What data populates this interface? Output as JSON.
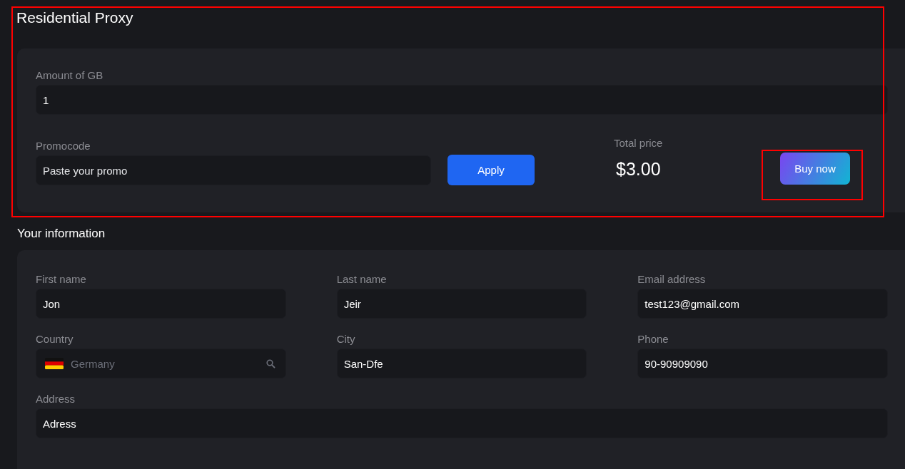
{
  "title": "Residential Proxy",
  "order": {
    "amount": {
      "label": "Amount of GB",
      "value": "1"
    },
    "promocode": {
      "label": "Promocode",
      "placeholder": "Paste your promo"
    },
    "apply_button": "Apply",
    "total": {
      "label": "Total price",
      "value": "$3.00"
    },
    "buy_button": "Buy now"
  },
  "info": {
    "title": "Your information",
    "fields": [
      {
        "kind": "text",
        "label": "First name",
        "value": "Jon"
      },
      {
        "kind": "text",
        "label": "Last name",
        "value": "Jeir"
      },
      {
        "kind": "text",
        "label": "Email address",
        "value": "test123@gmail.com"
      },
      {
        "kind": "country",
        "label": "Country",
        "placeholder": "Germany"
      },
      {
        "kind": "text",
        "label": "City",
        "value": "San-Dfe"
      },
      {
        "kind": "text",
        "label": "Phone",
        "value": "90-90909090"
      },
      {
        "kind": "wide",
        "label": "Address",
        "value": "Adress"
      }
    ]
  }
}
